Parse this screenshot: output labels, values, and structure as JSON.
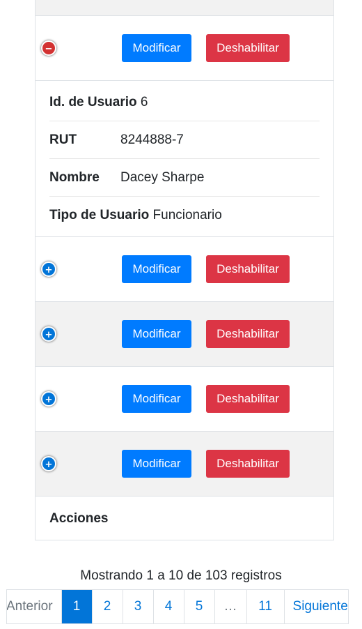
{
  "rows": [
    {
      "expanded": true,
      "modify_label": "Modificar",
      "disable_label": "Deshabilitar"
    },
    {
      "expanded": false,
      "modify_label": "Modificar",
      "disable_label": "Deshabilitar"
    },
    {
      "expanded": false,
      "modify_label": "Modificar",
      "disable_label": "Deshabilitar"
    },
    {
      "expanded": false,
      "modify_label": "Modificar",
      "disable_label": "Deshabilitar"
    },
    {
      "expanded": false,
      "modify_label": "Modificar",
      "disable_label": "Deshabilitar"
    }
  ],
  "details": {
    "id_label": "Id. de Usuario",
    "id_value": "6",
    "rut_label": "RUT",
    "rut_value": "8244888-7",
    "name_label": "Nombre",
    "name_value": "Dacey Sharpe",
    "type_label": "Tipo de Usuario",
    "type_value": "Funcionario"
  },
  "footer_label": "Acciones",
  "info_text": "Mostrando 1 a 10 de 103 registros",
  "pagination": {
    "prev": "Anterior",
    "pages": [
      "1",
      "2",
      "3",
      "4",
      "5",
      "…",
      "11"
    ],
    "next": "Siguiente",
    "active": "1"
  },
  "icons": {
    "expand": "plus-circle-icon",
    "collapse": "minus-circle-icon"
  },
  "colors": {
    "primary": "#007bff",
    "danger": "#dc3545",
    "toggle_open": "#d33333",
    "toggle_closed": "#0275d8"
  }
}
